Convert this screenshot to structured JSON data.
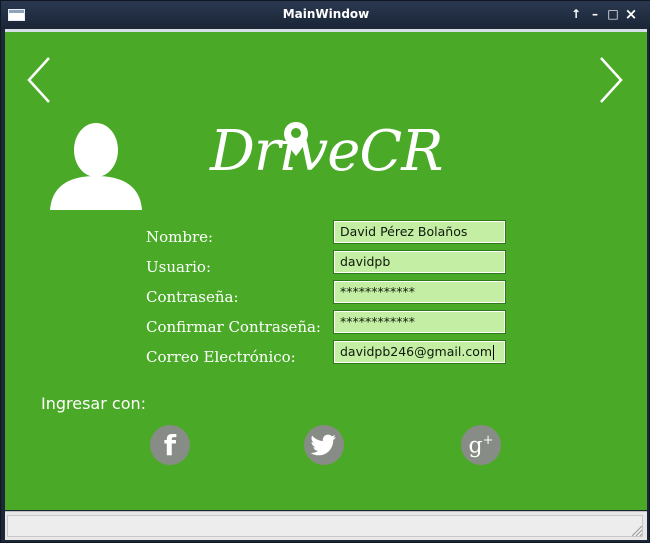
{
  "window": {
    "title": "MainWindow",
    "controls": {
      "shade": "↑",
      "minimize": "–",
      "maximize": "□",
      "close": "×"
    }
  },
  "nav": {
    "prev_icon": "chevron-left-icon",
    "next_icon": "chevron-right-icon"
  },
  "logo": {
    "text": "DriveCR",
    "icon": "map-pin-icon"
  },
  "form": {
    "nombre_label": "Nombre:",
    "nombre_value": "David Pérez Bolaños",
    "usuario_label": "Usuario:",
    "usuario_value": "davidpb",
    "contrasena_label": "Contraseña:",
    "contrasena_value": "************",
    "confirmar_label": "Confirmar Contraseña:",
    "confirmar_value": "************",
    "correo_label": "Correo Electrónico:",
    "correo_value": "davidpb246@gmail.com"
  },
  "social": {
    "heading": "Ingresar con:",
    "facebook_glyph": "f",
    "google_glyph": "g",
    "google_plus": "+"
  },
  "colors": {
    "background": "#4aaa28",
    "input_bg": "#c3eea4",
    "social_bg": "#888c86",
    "titlebar": "#1c2738"
  }
}
